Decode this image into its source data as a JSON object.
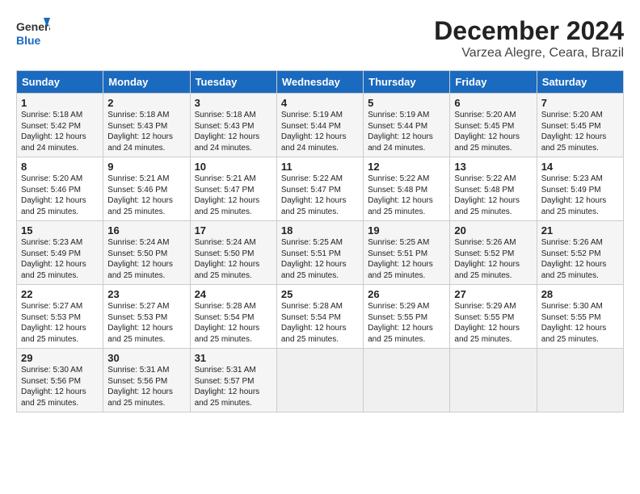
{
  "logo": {
    "line1": "General",
    "line2": "Blue"
  },
  "title": "December 2024",
  "location": "Varzea Alegre, Ceara, Brazil",
  "weekdays": [
    "Sunday",
    "Monday",
    "Tuesday",
    "Wednesday",
    "Thursday",
    "Friday",
    "Saturday"
  ],
  "weeks": [
    [
      {
        "day": "1",
        "rise": "5:18 AM",
        "set": "5:42 PM",
        "daylight": "12 hours and 24 minutes."
      },
      {
        "day": "2",
        "rise": "5:18 AM",
        "set": "5:43 PM",
        "daylight": "12 hours and 24 minutes."
      },
      {
        "day": "3",
        "rise": "5:18 AM",
        "set": "5:43 PM",
        "daylight": "12 hours and 24 minutes."
      },
      {
        "day": "4",
        "rise": "5:19 AM",
        "set": "5:44 PM",
        "daylight": "12 hours and 24 minutes."
      },
      {
        "day": "5",
        "rise": "5:19 AM",
        "set": "5:44 PM",
        "daylight": "12 hours and 24 minutes."
      },
      {
        "day": "6",
        "rise": "5:20 AM",
        "set": "5:45 PM",
        "daylight": "12 hours and 25 minutes."
      },
      {
        "day": "7",
        "rise": "5:20 AM",
        "set": "5:45 PM",
        "daylight": "12 hours and 25 minutes."
      }
    ],
    [
      {
        "day": "8",
        "rise": "5:20 AM",
        "set": "5:46 PM",
        "daylight": "12 hours and 25 minutes."
      },
      {
        "day": "9",
        "rise": "5:21 AM",
        "set": "5:46 PM",
        "daylight": "12 hours and 25 minutes."
      },
      {
        "day": "10",
        "rise": "5:21 AM",
        "set": "5:47 PM",
        "daylight": "12 hours and 25 minutes."
      },
      {
        "day": "11",
        "rise": "5:22 AM",
        "set": "5:47 PM",
        "daylight": "12 hours and 25 minutes."
      },
      {
        "day": "12",
        "rise": "5:22 AM",
        "set": "5:48 PM",
        "daylight": "12 hours and 25 minutes."
      },
      {
        "day": "13",
        "rise": "5:22 AM",
        "set": "5:48 PM",
        "daylight": "12 hours and 25 minutes."
      },
      {
        "day": "14",
        "rise": "5:23 AM",
        "set": "5:49 PM",
        "daylight": "12 hours and 25 minutes."
      }
    ],
    [
      {
        "day": "15",
        "rise": "5:23 AM",
        "set": "5:49 PM",
        "daylight": "12 hours and 25 minutes."
      },
      {
        "day": "16",
        "rise": "5:24 AM",
        "set": "5:50 PM",
        "daylight": "12 hours and 25 minutes."
      },
      {
        "day": "17",
        "rise": "5:24 AM",
        "set": "5:50 PM",
        "daylight": "12 hours and 25 minutes."
      },
      {
        "day": "18",
        "rise": "5:25 AM",
        "set": "5:51 PM",
        "daylight": "12 hours and 25 minutes."
      },
      {
        "day": "19",
        "rise": "5:25 AM",
        "set": "5:51 PM",
        "daylight": "12 hours and 25 minutes."
      },
      {
        "day": "20",
        "rise": "5:26 AM",
        "set": "5:52 PM",
        "daylight": "12 hours and 25 minutes."
      },
      {
        "day": "21",
        "rise": "5:26 AM",
        "set": "5:52 PM",
        "daylight": "12 hours and 25 minutes."
      }
    ],
    [
      {
        "day": "22",
        "rise": "5:27 AM",
        "set": "5:53 PM",
        "daylight": "12 hours and 25 minutes."
      },
      {
        "day": "23",
        "rise": "5:27 AM",
        "set": "5:53 PM",
        "daylight": "12 hours and 25 minutes."
      },
      {
        "day": "24",
        "rise": "5:28 AM",
        "set": "5:54 PM",
        "daylight": "12 hours and 25 minutes."
      },
      {
        "day": "25",
        "rise": "5:28 AM",
        "set": "5:54 PM",
        "daylight": "12 hours and 25 minutes."
      },
      {
        "day": "26",
        "rise": "5:29 AM",
        "set": "5:55 PM",
        "daylight": "12 hours and 25 minutes."
      },
      {
        "day": "27",
        "rise": "5:29 AM",
        "set": "5:55 PM",
        "daylight": "12 hours and 25 minutes."
      },
      {
        "day": "28",
        "rise": "5:30 AM",
        "set": "5:55 PM",
        "daylight": "12 hours and 25 minutes."
      }
    ],
    [
      {
        "day": "29",
        "rise": "5:30 AM",
        "set": "5:56 PM",
        "daylight": "12 hours and 25 minutes."
      },
      {
        "day": "30",
        "rise": "5:31 AM",
        "set": "5:56 PM",
        "daylight": "12 hours and 25 minutes."
      },
      {
        "day": "31",
        "rise": "5:31 AM",
        "set": "5:57 PM",
        "daylight": "12 hours and 25 minutes."
      },
      null,
      null,
      null,
      null
    ]
  ]
}
